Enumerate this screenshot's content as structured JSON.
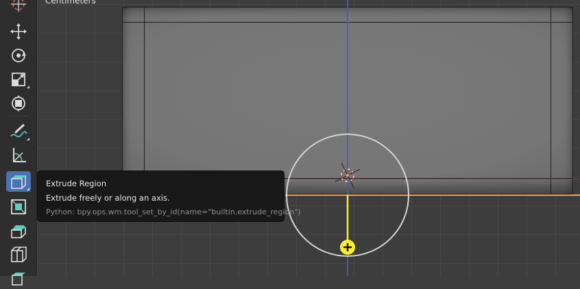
{
  "viewport": {
    "unit_label": "Centimeters"
  },
  "toolbar": {
    "tools": [
      {
        "name": "cursor-icon"
      },
      {
        "name": "move-icon"
      },
      {
        "name": "rotate-icon"
      },
      {
        "name": "scale-icon"
      },
      {
        "name": "transform-icon"
      },
      {
        "name": "annotate-icon"
      },
      {
        "name": "measure-icon"
      },
      {
        "name": "extrude-region-icon",
        "active": true
      },
      {
        "name": "inset-faces-icon"
      },
      {
        "name": "bevel-icon"
      },
      {
        "name": "loop-cut-icon"
      },
      {
        "name": "knife-icon"
      }
    ]
  },
  "tooltip": {
    "title": "Extrude Region",
    "description": "Extrude freely or along an axis.",
    "python": "Python: bpy.ops.wm.tool_set_by_id(name=\"builtin.extrude_region\")"
  },
  "colors": {
    "active_tool": "#4772b3",
    "selection_edge": "#ffa33d",
    "axis_z": "#3d62b8",
    "axis_x": "#a0403f",
    "gizmo_handle": "#ffee33",
    "tooltip_bg": "#181818"
  }
}
